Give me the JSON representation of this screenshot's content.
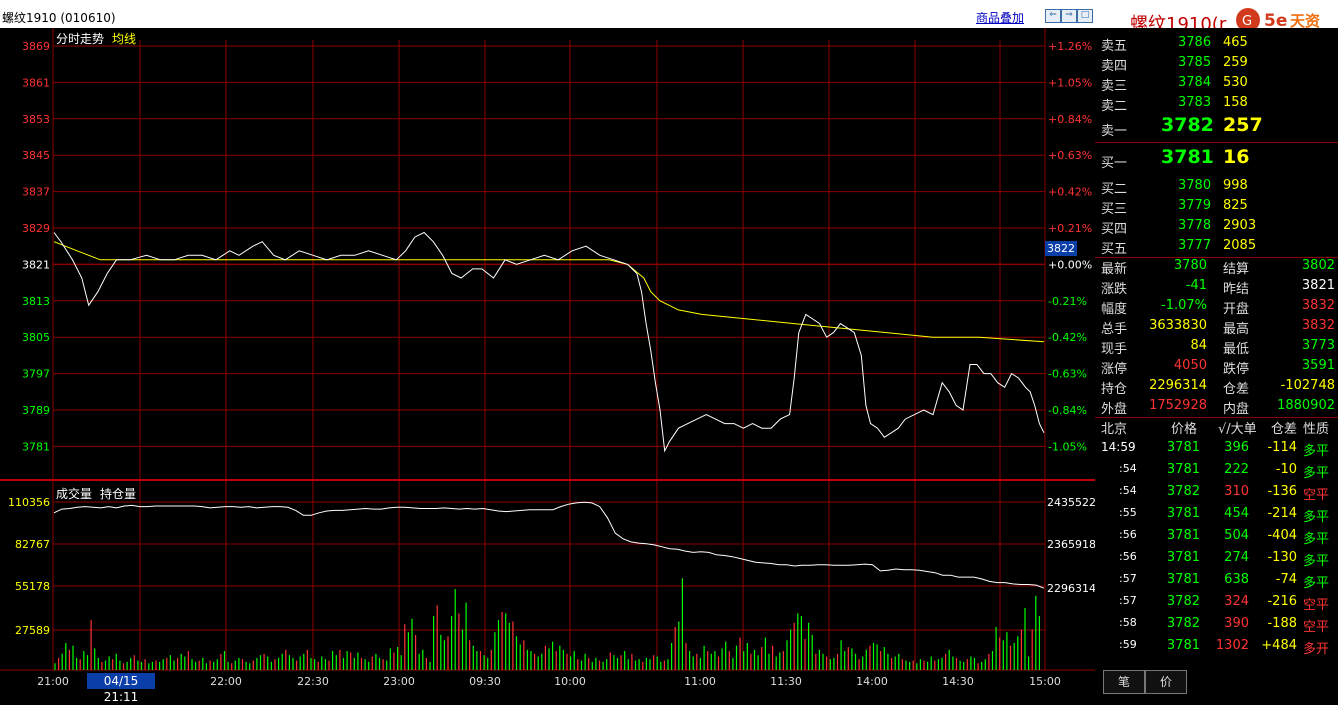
{
  "title": "螺纹1910 (010610)",
  "toolbar": {
    "overlay_label": "商品叠加"
  },
  "right_title": "螺纹1910(r",
  "logo": {
    "text": "5e天资",
    "subtext": "5etz.com"
  },
  "chart": {
    "indicator_label": "分时走势",
    "avg_label": "均线",
    "volume_label": "成交量",
    "oi_label": "持仓量",
    "price_ticks": [
      {
        "price": "3869",
        "pct": "+1.26%",
        "cls": "up"
      },
      {
        "price": "3861",
        "pct": "+1.05%",
        "cls": "up"
      },
      {
        "price": "3853",
        "pct": "+0.84%",
        "cls": "up"
      },
      {
        "price": "3845",
        "pct": "+0.63%",
        "cls": "up"
      },
      {
        "price": "3837",
        "pct": "+0.42%",
        "cls": "up"
      },
      {
        "price": "3829",
        "pct": "+0.21%",
        "cls": "up"
      },
      {
        "price": "3821",
        "pct": "+0.00%",
        "cls": "flat"
      },
      {
        "price": "3813",
        "pct": "-0.21%",
        "cls": "dn"
      },
      {
        "price": "3805",
        "pct": "-0.42%",
        "cls": "dn"
      },
      {
        "price": "3797",
        "pct": "-0.63%",
        "cls": "dn"
      },
      {
        "price": "3789",
        "pct": "-0.84%",
        "cls": "dn"
      },
      {
        "price": "3781",
        "pct": "-1.05%",
        "cls": "dn"
      }
    ],
    "volume_ticks": [
      "110356",
      "82767",
      "55178",
      "27589"
    ],
    "oi_ticks": [
      "2435522",
      "2365918",
      "2296314"
    ],
    "time_ticks": [
      "21:00",
      "22:00",
      "22:30",
      "23:00",
      "09:30",
      "10:00",
      "11:00",
      "11:30",
      "14:00",
      "14:30",
      "15:00"
    ],
    "cursor_date": "04/15 21:11",
    "current_price_marker": "3822",
    "colors": {
      "up": "#ff3333",
      "down": "#00ff00",
      "grid": "#8b0000",
      "price_line": "#ffffff",
      "avg_line": "#ffff00"
    }
  },
  "chart_data": {
    "type": "line",
    "title": "分时走势",
    "prev_settle": 3821,
    "ylim": [
      3777,
      3873
    ],
    "x_sessions": [
      "21:00-23:00",
      "09:00-10:15",
      "10:30-11:30",
      "13:30-15:00"
    ],
    "price_series": [
      [
        0,
        3828
      ],
      [
        3,
        3826
      ],
      [
        8,
        3822
      ],
      [
        12,
        3818
      ],
      [
        15,
        3812
      ],
      [
        19,
        3815
      ],
      [
        23,
        3819
      ],
      [
        27,
        3822
      ],
      [
        33,
        3822
      ],
      [
        40,
        3823
      ],
      [
        46,
        3822
      ],
      [
        52,
        3822
      ],
      [
        58,
        3823
      ],
      [
        64,
        3823
      ],
      [
        70,
        3822
      ],
      [
        76,
        3824
      ],
      [
        80,
        3823
      ],
      [
        86,
        3825
      ],
      [
        90,
        3826
      ],
      [
        95,
        3823
      ],
      [
        100,
        3822
      ],
      [
        106,
        3824
      ],
      [
        112,
        3823
      ],
      [
        118,
        3822
      ],
      [
        124,
        3823
      ],
      [
        130,
        3823
      ],
      [
        136,
        3824
      ],
      [
        142,
        3823
      ],
      [
        148,
        3822
      ],
      [
        152,
        3824
      ],
      [
        156,
        3827
      ],
      [
        160,
        3828
      ],
      [
        164,
        3826
      ],
      [
        168,
        3823
      ],
      [
        172,
        3819
      ],
      [
        176,
        3818
      ],
      [
        181,
        3820
      ],
      [
        185,
        3820
      ],
      [
        190,
        3818
      ],
      [
        195,
        3822
      ],
      [
        200,
        3821
      ],
      [
        206,
        3822
      ],
      [
        212,
        3823
      ],
      [
        218,
        3822
      ],
      [
        224,
        3824
      ],
      [
        230,
        3825
      ],
      [
        236,
        3823
      ],
      [
        242,
        3822
      ],
      [
        248,
        3821
      ],
      [
        252,
        3819
      ],
      [
        254,
        3815
      ],
      [
        256,
        3808
      ],
      [
        258,
        3802
      ],
      [
        260,
        3795
      ],
      [
        262,
        3789
      ],
      [
        264,
        3780
      ],
      [
        266,
        3782
      ],
      [
        270,
        3785
      ],
      [
        274,
        3786
      ],
      [
        278,
        3787
      ],
      [
        282,
        3788
      ],
      [
        286,
        3787
      ],
      [
        290,
        3786
      ],
      [
        294,
        3786
      ],
      [
        298,
        3785
      ],
      [
        302,
        3786
      ],
      [
        306,
        3785
      ],
      [
        310,
        3785
      ],
      [
        314,
        3787
      ],
      [
        318,
        3788
      ],
      [
        320,
        3796
      ],
      [
        322,
        3806
      ],
      [
        325,
        3810
      ],
      [
        328,
        3809
      ],
      [
        331,
        3808
      ],
      [
        334,
        3805
      ],
      [
        337,
        3806
      ],
      [
        340,
        3808
      ],
      [
        343,
        3807
      ],
      [
        346,
        3806
      ],
      [
        349,
        3801
      ],
      [
        351,
        3790
      ],
      [
        353,
        3786
      ],
      [
        356,
        3785
      ],
      [
        359,
        3783
      ],
      [
        362,
        3784
      ],
      [
        365,
        3785
      ],
      [
        368,
        3787
      ],
      [
        372,
        3788
      ],
      [
        376,
        3789
      ],
      [
        380,
        3788
      ],
      [
        384,
        3795
      ],
      [
        387,
        3793
      ],
      [
        390,
        3790
      ],
      [
        393,
        3789
      ],
      [
        396,
        3799
      ],
      [
        399,
        3799
      ],
      [
        402,
        3797
      ],
      [
        405,
        3797
      ],
      [
        408,
        3795
      ],
      [
        411,
        3794
      ],
      [
        414,
        3797
      ],
      [
        417,
        3796
      ],
      [
        420,
        3794
      ],
      [
        422,
        3793
      ],
      [
        424,
        3790
      ],
      [
        426,
        3786
      ],
      [
        428,
        3784
      ]
    ],
    "avg_series": [
      [
        0,
        3826
      ],
      [
        10,
        3824
      ],
      [
        20,
        3822
      ],
      [
        40,
        3822
      ],
      [
        80,
        3822
      ],
      [
        120,
        3822
      ],
      [
        160,
        3822
      ],
      [
        200,
        3822
      ],
      [
        240,
        3822
      ],
      [
        248,
        3821
      ],
      [
        255,
        3818
      ],
      [
        258,
        3815
      ],
      [
        262,
        3813
      ],
      [
        270,
        3811
      ],
      [
        280,
        3810
      ],
      [
        300,
        3809
      ],
      [
        320,
        3808
      ],
      [
        340,
        3807
      ],
      [
        360,
        3806
      ],
      [
        380,
        3805
      ],
      [
        400,
        3805
      ],
      [
        428,
        3804
      ]
    ],
    "volume_ylim": [
      0,
      137945
    ],
    "volume_series": [
      {
        "name": "成交量",
        "values": [
          5000,
          9000,
          12000,
          20000,
          15000,
          18000,
          9000,
          8000,
          14000,
          11000,
          37000,
          16000,
          9000,
          6000,
          7000,
          10000,
          8000,
          12000,
          7000,
          5000,
          6000,
          9000,
          11000,
          7000,
          6000,
          8000,
          5000,
          6000,
          7000,
          6000,
          8000,
          9000,
          11000,
          7000,
          9000,
          12000,
          10000,
          14000,
          8000,
          6000,
          7000,
          9000,
          5000,
          7000,
          6000,
          8000,
          12000,
          14000,
          6000,
          5000,
          7000,
          9000,
          8000,
          6000,
          5000,
          7000,
          9000,
          11000,
          12000,
          10000,
          6000,
          8000,
          9000,
          12000,
          15000,
          11000,
          9000,
          7000,
          10000,
          12000,
          15000,
          9000,
          8000,
          6000,
          10000,
          8000,
          7000,
          14000,
          11000,
          15000,
          9000,
          14000,
          13000,
          9000,
          13000,
          9000,
          8000,
          6000,
          10000,
          12000,
          9000,
          8000,
          7000,
          16000,
          13000,
          17000,
          11000,
          34000,
          28000,
          38000,
          26000,
          12000,
          15000,
          9000,
          6000,
          40000,
          48000,
          26000,
          22000,
          25000,
          40000,
          60000,
          42000,
          30000,
          50000,
          22000,
          18000,
          14000,
          14000,
          11000,
          9000,
          15000,
          28000,
          37000,
          43000,
          42000,
          35000,
          36000,
          25000,
          19000,
          22000,
          15000,
          14000,
          12000,
          10000,
          12000,
          18000,
          16000,
          21000,
          14000,
          18000,
          15000,
          12000,
          10000,
          14000,
          8000,
          7000,
          12000,
          9000,
          6000,
          9000,
          7000,
          6000,
          8000,
          13000,
          11000,
          9000,
          11000,
          14000,
          8000,
          12000,
          7000,
          8000,
          6000,
          9000,
          8000,
          11000,
          10000,
          6000,
          7000,
          8000,
          20000,
          32000,
          36000,
          68000,
          20000,
          14000,
          10000,
          12000,
          9000,
          18000,
          14000,
          12000,
          14000,
          10000,
          16000,
          21000,
          14000,
          9000,
          18000,
          24000,
          14000,
          20000,
          12000,
          15000,
          11000,
          17000,
          24000,
          12000,
          18000,
          10000,
          13000,
          14000,
          22000,
          30000,
          35000,
          42000,
          40000,
          23000,
          35000,
          26000,
          12000,
          15000,
          12000,
          10000,
          8000,
          9000,
          12000,
          22000,
          14000,
          17000,
          16000,
          12000,
          8000,
          10000,
          15000,
          18000,
          20000,
          19000,
          14000,
          17000,
          12000,
          9000,
          10000,
          12000,
          8000,
          7000,
          6000,
          7000,
          5000,
          8000,
          7000,
          6000,
          10000,
          7000,
          8000,
          9000,
          12000,
          15000,
          10000,
          9000,
          7000,
          6000,
          8000,
          10000,
          9000,
          5000,
          6000,
          8000,
          12000,
          14000,
          32000,
          24000,
          22000,
          28000,
          18000,
          20000,
          25000,
          30000,
          46000,
          10000,
          30000,
          55000,
          40000
        ]
      },
      {
        "name": "持仓量",
        "values": [
          2418000,
          2424000,
          2425000,
          2427000,
          2428000,
          2427000,
          2426000,
          2428000,
          2426000,
          2429000,
          2430000,
          2428000,
          2428000,
          2429000,
          2429000,
          2429000,
          2429000,
          2429000,
          2429000,
          2428000,
          2426000,
          2427000,
          2428000,
          2428000,
          2427000,
          2428000,
          2426000,
          2427000,
          2428000,
          2428000,
          2427000,
          2422000,
          2414000,
          2414000,
          2418000,
          2421000,
          2422000,
          2422000,
          2423000,
          2424000,
          2425000,
          2424000,
          2424000,
          2426000,
          2427000,
          2427000,
          2426000,
          2425000,
          2425000,
          2425000,
          2426000,
          2425000,
          2424000,
          2425000,
          2424000,
          2425000,
          2423000,
          2421000,
          2420000,
          2421000,
          2422000,
          2423000,
          2423000,
          2423000,
          2423000,
          2428000,
          2432000,
          2434000,
          2435000,
          2434000,
          2428000,
          2410000,
          2385000,
          2376000,
          2371000,
          2369000,
          2368000,
          2366000,
          2363000,
          2360000,
          2359000,
          2356000,
          2354000,
          2355000,
          2354000,
          2350000,
          2349000,
          2347000,
          2344000,
          2341000,
          2338000,
          2337000,
          2336000,
          2334000,
          2334000,
          2332000,
          2333000,
          2333000,
          2334000,
          2334000,
          2333000,
          2333000,
          2333000,
          2334000,
          2335000,
          2334000,
          2324000,
          2325000,
          2327000,
          2326000,
          2326000,
          2325000,
          2323000,
          2321000,
          2317000,
          2317000,
          2314000,
          2314000,
          2314000,
          2311000,
          2307000,
          2305000,
          2305000,
          2303000,
          2302000,
          2302000,
          2301000,
          2296000
        ]
      }
    ]
  },
  "quote": {
    "asks": [
      {
        "label": "卖五",
        "price": "3786",
        "vol": "465"
      },
      {
        "label": "卖四",
        "price": "3785",
        "vol": "259"
      },
      {
        "label": "卖三",
        "price": "3784",
        "vol": "530"
      },
      {
        "label": "卖二",
        "price": "3783",
        "vol": "158"
      },
      {
        "label": "卖一",
        "price": "3782",
        "vol": "257"
      }
    ],
    "bids": [
      {
        "label": "买一",
        "price": "3781",
        "vol": "16"
      },
      {
        "label": "买二",
        "price": "3780",
        "vol": "998"
      },
      {
        "label": "买三",
        "price": "3779",
        "vol": "825"
      },
      {
        "label": "买四",
        "price": "3778",
        "vol": "2903"
      },
      {
        "label": "买五",
        "price": "3777",
        "vol": "2085"
      }
    ],
    "stats": [
      {
        "l1": "最新",
        "v1": "3780",
        "c1": "g",
        "l2": "结算",
        "v2": "3802",
        "c2": "g"
      },
      {
        "l1": "涨跌",
        "v1": "-41",
        "c1": "g",
        "l2": "昨结",
        "v2": "3821",
        "c2": "w"
      },
      {
        "l1": "幅度",
        "v1": "-1.07%",
        "c1": "g",
        "l2": "开盘",
        "v2": "3832",
        "c2": "r"
      },
      {
        "l1": "总手",
        "v1": "3633830",
        "c1": "y",
        "l2": "最高",
        "v2": "3832",
        "c2": "r"
      },
      {
        "l1": "现手",
        "v1": "84",
        "c1": "y",
        "l2": "最低",
        "v2": "3773",
        "c2": "g"
      },
      {
        "l1": "涨停",
        "v1": "4050",
        "c1": "r",
        "l2": "跌停",
        "v2": "3591",
        "c2": "g"
      },
      {
        "l1": "持仓",
        "v1": "2296314",
        "c1": "y",
        "l2": "仓差",
        "v2": "-102748",
        "c2": "y"
      },
      {
        "l1": "外盘",
        "v1": "1752928",
        "c1": "r",
        "l2": "内盘",
        "v2": "1880902",
        "c2": "g"
      }
    ],
    "ticks_header": {
      "place": "北京",
      "price": "价格",
      "vol": "√/大单",
      "oi": "仓差",
      "nature": "性质"
    },
    "ticks": [
      {
        "time": "14:59",
        "price": "3781",
        "vol": "396",
        "vc": "g",
        "oi": "-114",
        "nature": "多平",
        "nc": "g"
      },
      {
        "time": ":54",
        "price": "3781",
        "vol": "222",
        "vc": "g",
        "oi": "-10",
        "nature": "多平",
        "nc": "g"
      },
      {
        "time": ":54",
        "price": "3782",
        "vol": "310",
        "vc": "r",
        "oi": "-136",
        "nature": "空平",
        "nc": "r"
      },
      {
        "time": ":55",
        "price": "3781",
        "vol": "454",
        "vc": "g",
        "oi": "-214",
        "nature": "多平",
        "nc": "g"
      },
      {
        "time": ":56",
        "price": "3781",
        "vol": "504",
        "vc": "g",
        "oi": "-404",
        "nature": "多平",
        "nc": "g"
      },
      {
        "time": ":56",
        "price": "3781",
        "vol": "274",
        "vc": "g",
        "oi": "-130",
        "nature": "多平",
        "nc": "g"
      },
      {
        "time": ":57",
        "price": "3781",
        "vol": "638",
        "vc": "g",
        "oi": "-74",
        "nature": "多平",
        "nc": "g"
      },
      {
        "time": ":57",
        "price": "3782",
        "vol": "324",
        "vc": "r",
        "oi": "-216",
        "nature": "空平",
        "nc": "r"
      },
      {
        "time": ":58",
        "price": "3782",
        "vol": "390",
        "vc": "r",
        "oi": "-188",
        "nature": "空平",
        "nc": "r"
      },
      {
        "time": ":59",
        "price": "3781",
        "vol": "1302",
        "vc": "r",
        "oi": "+484",
        "nature": "多开",
        "nc": "r"
      }
    ],
    "tabs": [
      "笔",
      "价"
    ]
  }
}
